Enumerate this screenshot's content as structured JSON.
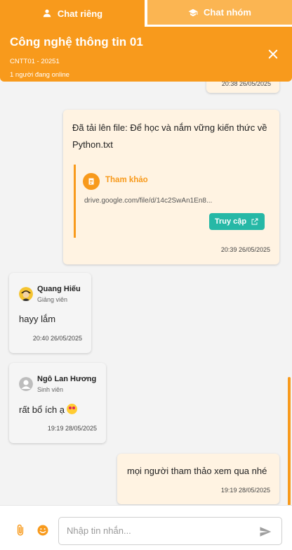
{
  "tabs": [
    {
      "label": "Chat riêng",
      "icon": "person-icon",
      "active": false
    },
    {
      "label": "Chat nhóm",
      "icon": "graduation-cap-icon",
      "active": true
    }
  ],
  "header": {
    "title": "Công nghệ thông tin 01",
    "class_code": "CNTT01 - 20251",
    "online": "1 người đang online",
    "close_icon": "close-icon"
  },
  "messages": [
    {
      "type": "sent",
      "time": "20:38 26/05/2025"
    },
    {
      "type": "sent",
      "text": "Đã tải lên file: Để học và nắm vững kiến thức về Python.txt",
      "reference": {
        "label": "Tham khảo",
        "url": "drive.google.com/file/d/14c2SwAn1En8...",
        "button": "Truy cập"
      },
      "time": "20:39 26/05/2025"
    },
    {
      "type": "received",
      "sender": "Quang Hiếu",
      "role": "Giảng viên",
      "text": "hayy lắm",
      "time": "20:40 26/05/2025"
    },
    {
      "type": "received",
      "sender": "Ngô Lan Hương",
      "role": "Sinh viên",
      "text": "rất bổ ích ạ",
      "time": "19:19 28/05/2025"
    },
    {
      "type": "sent",
      "text": "mọi người tham thảo xem qua nhé",
      "time": "19:19 28/05/2025"
    }
  ],
  "composer": {
    "placeholder": "Nhập tin nhắn..."
  },
  "colors": {
    "accent": "#f89a1c",
    "accent_light": "#fbb552",
    "teal": "#26b8a6",
    "sent_bg": "#fff3e2"
  }
}
